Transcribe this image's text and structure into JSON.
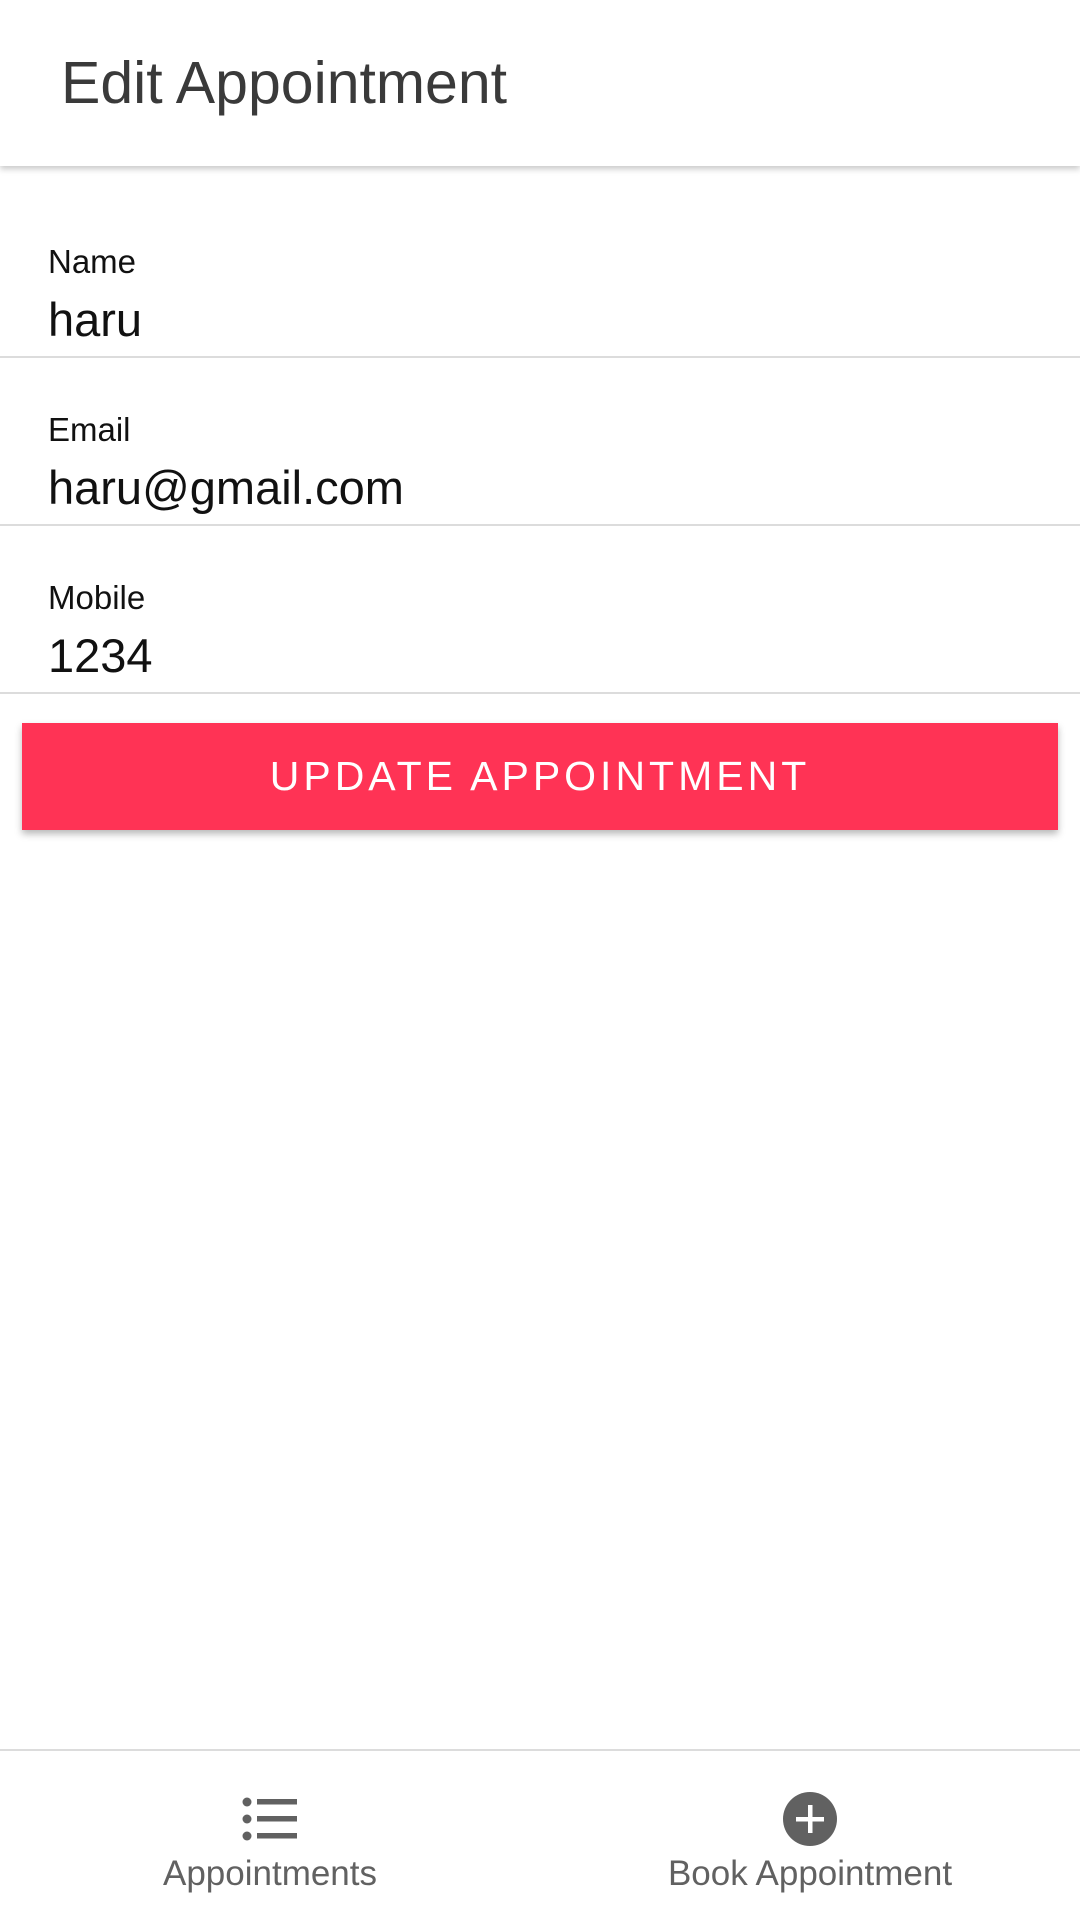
{
  "header": {
    "title": "Edit Appointment"
  },
  "form": {
    "name": {
      "label": "Name",
      "value": "haru"
    },
    "email": {
      "label": "Email",
      "value": "haru@gmail.com"
    },
    "mobile": {
      "label": "Mobile",
      "value": "1234"
    },
    "submit_label": "UPDATE APPOINTMENT"
  },
  "bottom_nav": {
    "items": [
      {
        "label": "Appointments",
        "icon": "list-icon"
      },
      {
        "label": "Book Appointment",
        "icon": "add-circle-icon"
      }
    ]
  },
  "colors": {
    "accent": "#ff3355",
    "icon": "#616161"
  }
}
